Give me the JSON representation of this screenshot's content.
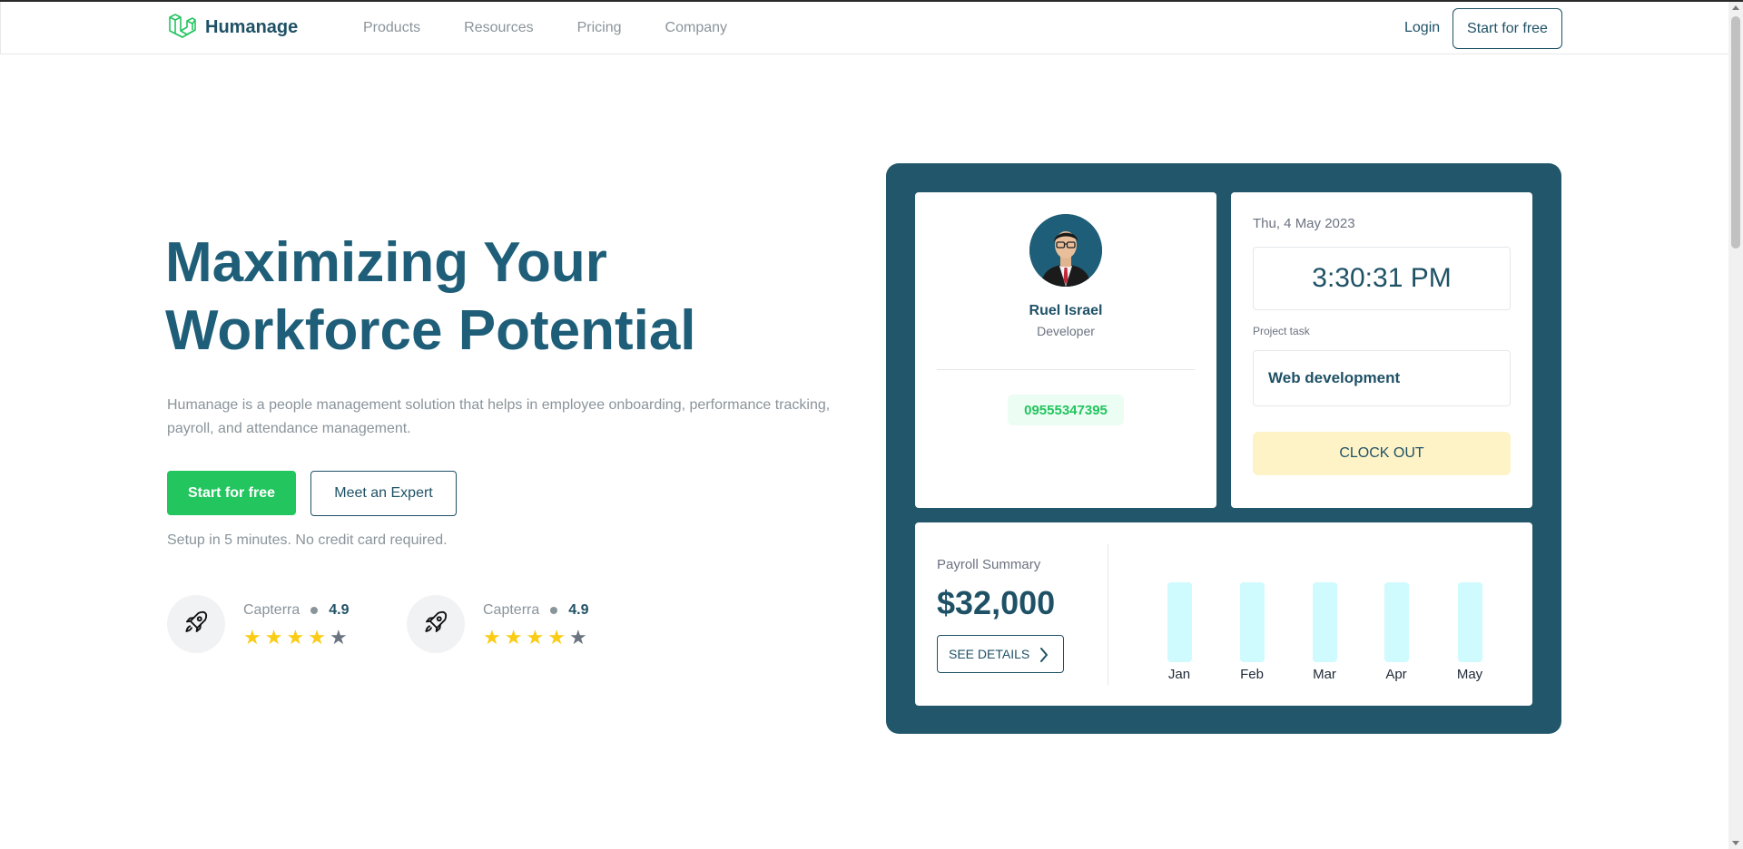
{
  "header": {
    "brand": "Humanage",
    "nav": [
      "Products",
      "Resources",
      "Pricing",
      "Company"
    ],
    "login": "Login",
    "cta": "Start for free"
  },
  "hero": {
    "title_line1": "Maximizing Your",
    "title_line2": "Workforce Potential",
    "description": "Humanage is a people management solution that helps in employee onboarding, performance tracking, payroll, and attendance management.",
    "primary_button": "Start for free",
    "secondary_button": "Meet an Expert",
    "note": "Setup in 5 minutes. No credit card required."
  },
  "ratings": [
    {
      "name": "Capterra",
      "score": "4.9",
      "stars": 4
    },
    {
      "name": "Capterra",
      "score": "4.9",
      "stars": 4
    }
  ],
  "dashboard": {
    "profile": {
      "name": "Ruel Israel",
      "role": "Developer",
      "phone": "09555347395"
    },
    "clock": {
      "date": "Thu, 4 May 2023",
      "time": "3:30:31 PM",
      "task_label": "Project task",
      "task_value": "Web development",
      "clockout_label": "CLOCK OUT"
    },
    "payroll": {
      "label": "Payroll Summary",
      "amount": "$32,000",
      "details_button": "SEE DETAILS",
      "months": [
        "Jan",
        "Feb",
        "Mar",
        "Apr",
        "May"
      ]
    }
  },
  "colors": {
    "primary_dark": "#1f5166",
    "accent_green": "#22c55e",
    "panel_bg": "#21566b",
    "star": "#facc15",
    "clockout_bg": "#fef3c7",
    "bar": "#cffafe"
  },
  "icons": {
    "logo": "laravel-cube-icon",
    "rating": "rocket-icon",
    "details": "chevron-right-icon"
  }
}
